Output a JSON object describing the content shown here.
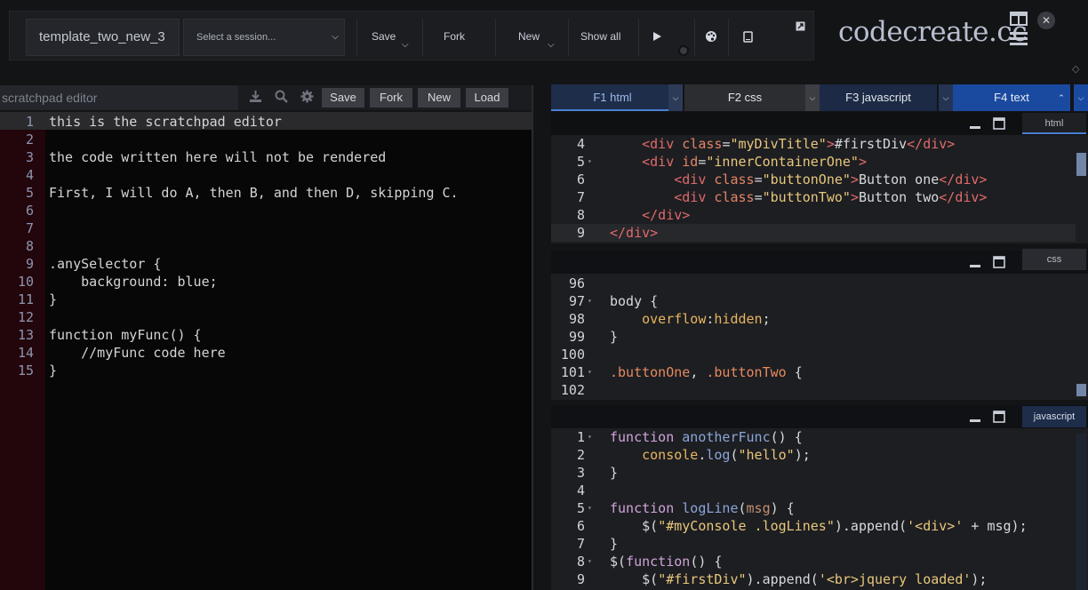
{
  "toolbar": {
    "template_name": "template_two_new_3",
    "session_placeholder": "Select a session...",
    "save_label": "Save",
    "fork_label": "Fork",
    "new_label": "New",
    "show_all_label": "Show all"
  },
  "brand": {
    "logo_text": "codecreate.cc"
  },
  "scratchpad": {
    "title": "scratchpad editor",
    "save_label": "Save",
    "fork_label": "Fork",
    "new_label": "New",
    "load_label": "Load",
    "lines": [
      {
        "n": "1",
        "text": "this is the scratchpad editor"
      },
      {
        "n": "2",
        "text": ""
      },
      {
        "n": "3",
        "text": "the code written here will not be rendered"
      },
      {
        "n": "4",
        "text": ""
      },
      {
        "n": "5",
        "text": "First, I will do A, then B, and then D, skipping C."
      },
      {
        "n": "6",
        "text": ""
      },
      {
        "n": "7",
        "text": ""
      },
      {
        "n": "8",
        "text": ""
      },
      {
        "n": "9",
        "text": ".anySelector {"
      },
      {
        "n": "10",
        "text": "    background: blue;"
      },
      {
        "n": "11",
        "text": "}"
      },
      {
        "n": "12",
        "text": ""
      },
      {
        "n": "13",
        "text": "function myFunc() {"
      },
      {
        "n": "14",
        "text": "    //myFunc code here"
      },
      {
        "n": "15",
        "text": "}"
      }
    ]
  },
  "tabs": [
    {
      "label": "F1 html"
    },
    {
      "label": "F2 css"
    },
    {
      "label": "F3 javascript"
    },
    {
      "label": "F4 text"
    }
  ],
  "panes": {
    "html": {
      "label": "html",
      "lines": [
        {
          "n": "4",
          "fold": false,
          "html": "    <span class=\"t-tag\">&lt;div</span> <span class=\"t-attr\">class</span>=<span class=\"t-str\">\"myDivTitle\"</span><span class=\"t-tag\">&gt;</span>#firstDiv<span class=\"t-tag\">&lt;/div&gt;</span>"
        },
        {
          "n": "5",
          "fold": true,
          "html": "    <span class=\"t-tag\">&lt;div</span> <span class=\"t-attr\">id</span>=<span class=\"t-str\">\"innerContainerOne\"</span><span class=\"t-tag\">&gt;</span>"
        },
        {
          "n": "6",
          "fold": false,
          "html": "        <span class=\"t-tag\">&lt;div</span> <span class=\"t-attr\">class</span>=<span class=\"t-str\">\"buttonOne\"</span><span class=\"t-tag\">&gt;</span>Button one<span class=\"t-tag\">&lt;/div&gt;</span>"
        },
        {
          "n": "7",
          "fold": false,
          "html": "        <span class=\"t-tag\">&lt;div</span> <span class=\"t-attr\">class</span>=<span class=\"t-str\">\"buttonTwo\"</span><span class=\"t-tag\">&gt;</span>Button two<span class=\"t-tag\">&lt;/div&gt;</span>"
        },
        {
          "n": "8",
          "fold": false,
          "html": "    <span class=\"t-tag\">&lt;/div&gt;</span>"
        },
        {
          "n": "9",
          "fold": false,
          "html": "<span class=\"t-tag\">&lt;/div&gt;</span>"
        }
      ]
    },
    "css": {
      "label": "css",
      "lines": [
        {
          "n": "96",
          "fold": false,
          "html": ""
        },
        {
          "n": "97",
          "fold": true,
          "html": "body {"
        },
        {
          "n": "98",
          "fold": false,
          "html": "    <span class=\"t-prop\">overflow</span>:<span class=\"t-prop\">hidden</span>;"
        },
        {
          "n": "99",
          "fold": false,
          "html": "}"
        },
        {
          "n": "100",
          "fold": false,
          "html": ""
        },
        {
          "n": "101",
          "fold": true,
          "html": "<span class=\"t-sel\">.buttonOne</span>, <span class=\"t-sel\">.buttonTwo</span> {"
        },
        {
          "n": "102",
          "fold": false,
          "html": ""
        }
      ]
    },
    "javascript": {
      "label": "javascript",
      "lines": [
        {
          "n": "1",
          "fold": true,
          "html": "<span class=\"t-kw\">function</span> <span class=\"t-fn\">anotherFunc</span>() {"
        },
        {
          "n": "2",
          "fold": false,
          "html": "    <span class=\"t-obj\">console</span>.<span class=\"t-fn\">log</span>(<span class=\"t-str\">\"hello\"</span>);"
        },
        {
          "n": "3",
          "fold": false,
          "html": "}"
        },
        {
          "n": "4",
          "fold": false,
          "html": ""
        },
        {
          "n": "5",
          "fold": true,
          "html": "<span class=\"t-kw\">function</span> <span class=\"t-fn\">logLine</span>(<span class=\"t-var\">msg</span>) {"
        },
        {
          "n": "6",
          "fold": false,
          "html": "    $(<span class=\"t-str\">\"#myConsole .logLines\"</span>).append(<span class=\"t-str\">'&lt;div&gt;'</span> + msg);"
        },
        {
          "n": "7",
          "fold": false,
          "html": "}"
        },
        {
          "n": "8",
          "fold": true,
          "html": "$(<span class=\"t-kw\">function</span>() {"
        },
        {
          "n": "9",
          "fold": false,
          "html": "    $(<span class=\"t-str\">\"#firstDiv\"</span>).append(<span class=\"t-str\">'&lt;br&gt;jquery loaded'</span>);"
        }
      ]
    }
  },
  "colors": {
    "accent": "#4a7fd1",
    "tab_active_bg": "#1d2d4a",
    "scratch_gutter": "#23050c"
  }
}
